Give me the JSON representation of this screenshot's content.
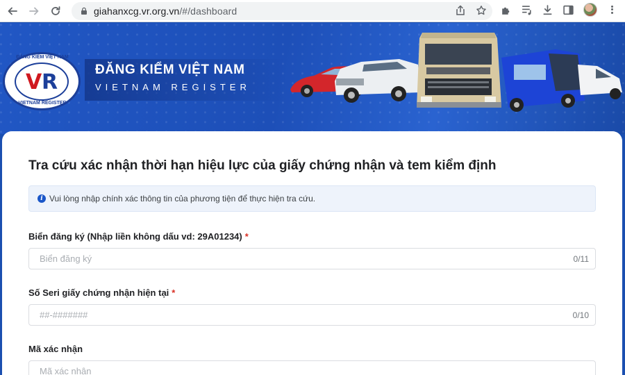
{
  "browser": {
    "url_domain": "giahanxcg.vr.org.vn",
    "url_path": "/#/dashboard",
    "icons": [
      "back-arrow-icon",
      "forward-arrow-icon",
      "reload-icon",
      "lock-icon",
      "share-icon",
      "bookmark-star-icon",
      "extensions-icon",
      "media-queue-icon",
      "download-icon",
      "side-panel-icon",
      "profile-avatar",
      "more-menu-icon"
    ]
  },
  "banner": {
    "logo_top_text": "ĐĂNG KIỂM VIỆT NAM",
    "logo_bottom_text": "VIETNAM REGISTER",
    "title": "ĐĂNG KIỂM VIỆT NAM",
    "subtitle": "VIETNAM REGISTER"
  },
  "form": {
    "title": "Tra cứu xác nhận thời hạn hiệu lực của giấy chứng nhận và tem kiểm định",
    "info_message": "Vui lòng nhập chính xác thông tin của phương tiện để thực hiện tra cứu.",
    "fields": [
      {
        "label": "Biển đăng ký (Nhập liền không dấu vd: 29A01234)",
        "required_mark": "*",
        "placeholder": "Biển đăng ký",
        "value": "",
        "counter": "0/11"
      },
      {
        "label": "Số Seri giấy chứng nhận hiện tại",
        "required_mark": "*",
        "placeholder": "##-#######",
        "value": "",
        "counter": "0/10"
      },
      {
        "label": "Mã xác nhận",
        "required_mark": "",
        "placeholder": "Mã xác nhận",
        "value": ""
      }
    ]
  },
  "colors": {
    "banner_blue": "#1d4fb8",
    "required_red": "#d93025",
    "info_bg": "#eef3fb",
    "info_icon": "#1a56c8"
  }
}
